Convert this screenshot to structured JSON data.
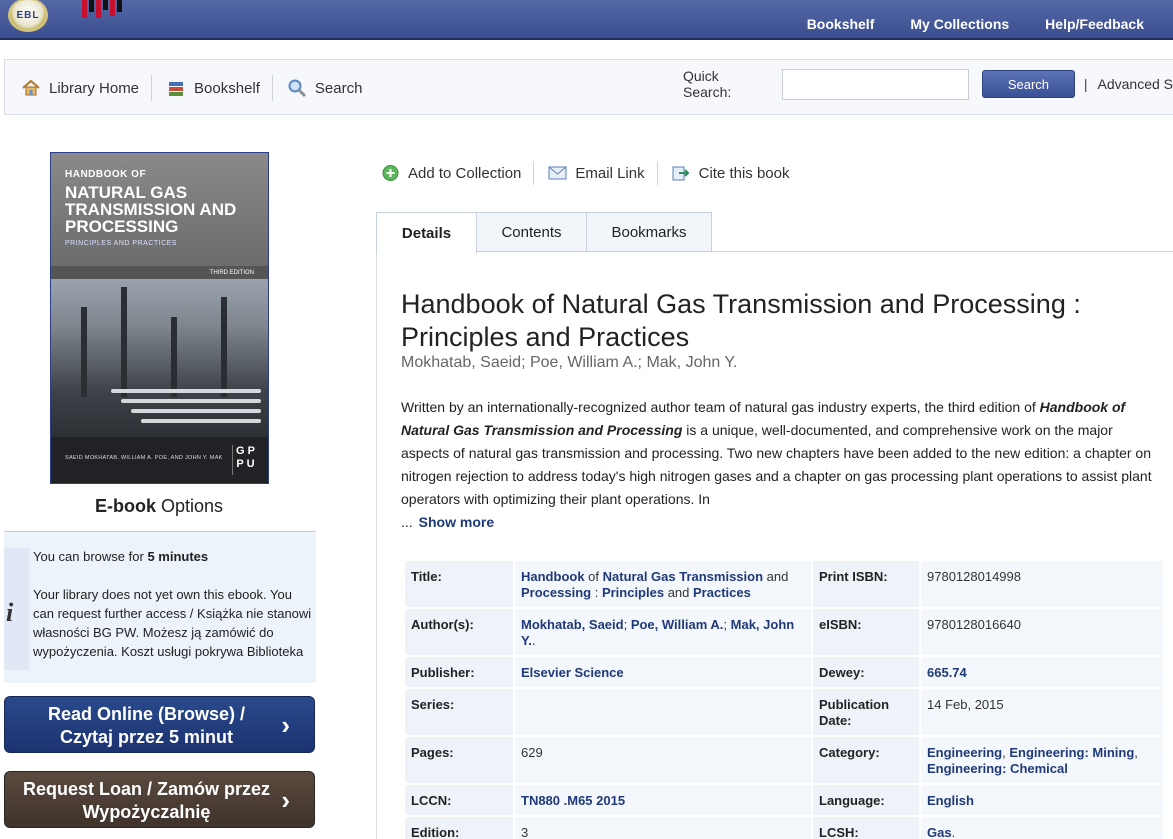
{
  "topbar": {
    "logo_text": "EBL",
    "nav": [
      "Bookshelf",
      "My Collections",
      "Help/Feedback"
    ]
  },
  "subnav": {
    "items": [
      "Library Home",
      "Bookshelf",
      "Search"
    ],
    "quick_label": "Quick Search:",
    "quick_value": "",
    "search_button": "Search",
    "pipe": "|",
    "advanced": "Advanced S"
  },
  "cover": {
    "line1": "HANDBOOK OF",
    "line2": "NATURAL GAS TRANSMISSION AND PROCESSING",
    "line3": "PRINCIPLES AND PRACTICES",
    "edition": "THIRD EDITION",
    "authors": "SAEID MOKHATAB, WILLIAM A. POE, AND JOHN Y. MAK",
    "publisher_mark": "G P P U"
  },
  "ebook": {
    "title_bold": "E-book",
    "title_rest": " Options",
    "browse_prefix": "You can browse for ",
    "browse_time": "5 minutes",
    "notice": "Your library does not yet own this ebook. You can request further access / Książka nie stanowi własności BG PW. Możesz ją zamówić do wypożyczenia. Koszt usługi pokrywa Biblioteka",
    "read_button": "Read Online (Browse) / Czytaj przez 5 minut",
    "loan_button": "Request Loan / Zamów przez Wypożyczalnię",
    "chevron": "›"
  },
  "actions": [
    "Add to Collection",
    "Email Link",
    "Cite this book"
  ],
  "tabs": [
    "Details",
    "Contents",
    "Bookmarks"
  ],
  "book": {
    "title": "Handbook of Natural Gas Transmission and Processing : Principles and Practices",
    "authors": "Mokhatab, Saeid; Poe, William A.; Mak, John Y.",
    "desc_a": "Written by an internationally-recognized author team of natural gas industry experts, the third edition of ",
    "desc_b": "Handbook of Natural Gas Transmission and Processing",
    "desc_c": " is a unique, well-documented, and comprehensive work on the major aspects of natural gas transmission and processing. Two new chapters have been added to the new edition: a chapter on nitrogen rejection to address today's high nitrogen gases and a chapter on gas processing plant operations to assist plant operators with optimizing their plant operations. In",
    "ellipsis": "...",
    "show_more": "Show more"
  },
  "meta": {
    "title_label": "Title:",
    "title_parts": [
      "Handbook",
      " of ",
      "Natural Gas Transmission",
      " and ",
      "Processing",
      " : ",
      "Principles",
      " and ",
      "Practices"
    ],
    "print_isbn_label": "Print ISBN:",
    "print_isbn": "9780128014998",
    "authors_label": "Author(s):",
    "authors_parts": [
      "Mokhatab, Saeid",
      "; ",
      "Poe, William A.",
      "; ",
      "Mak, John Y.",
      "."
    ],
    "eisbn_label": "eISBN:",
    "eisbn": "9780128016640",
    "publisher_label": "Publisher:",
    "publisher": "Elsevier Science",
    "dewey_label": "Dewey:",
    "dewey": "665.74",
    "series_label": "Series:",
    "series": "",
    "pubdate_label": "Publication Date:",
    "pubdate": "14 Feb, 2015",
    "pages_label": "Pages:",
    "pages": "629",
    "category_label": "Category:",
    "category_parts": [
      "Engineering",
      ", ",
      "Engineering: Mining",
      ", ",
      "Engineering: Chemical"
    ],
    "lccn_label": "LCCN:",
    "lccn": "TN880 .M65 2015",
    "language_label": "Language:",
    "language": "English",
    "edition_label": "Edition:",
    "edition": "3",
    "lcsh_label": "LCSH:",
    "lcsh": "Gas",
    "lcsh_tail": "."
  },
  "colors": {
    "topbar": "#3b4e8f",
    "link": "#1f3a7a",
    "read_button": "#1c3370",
    "loan_button": "#3f332b"
  }
}
